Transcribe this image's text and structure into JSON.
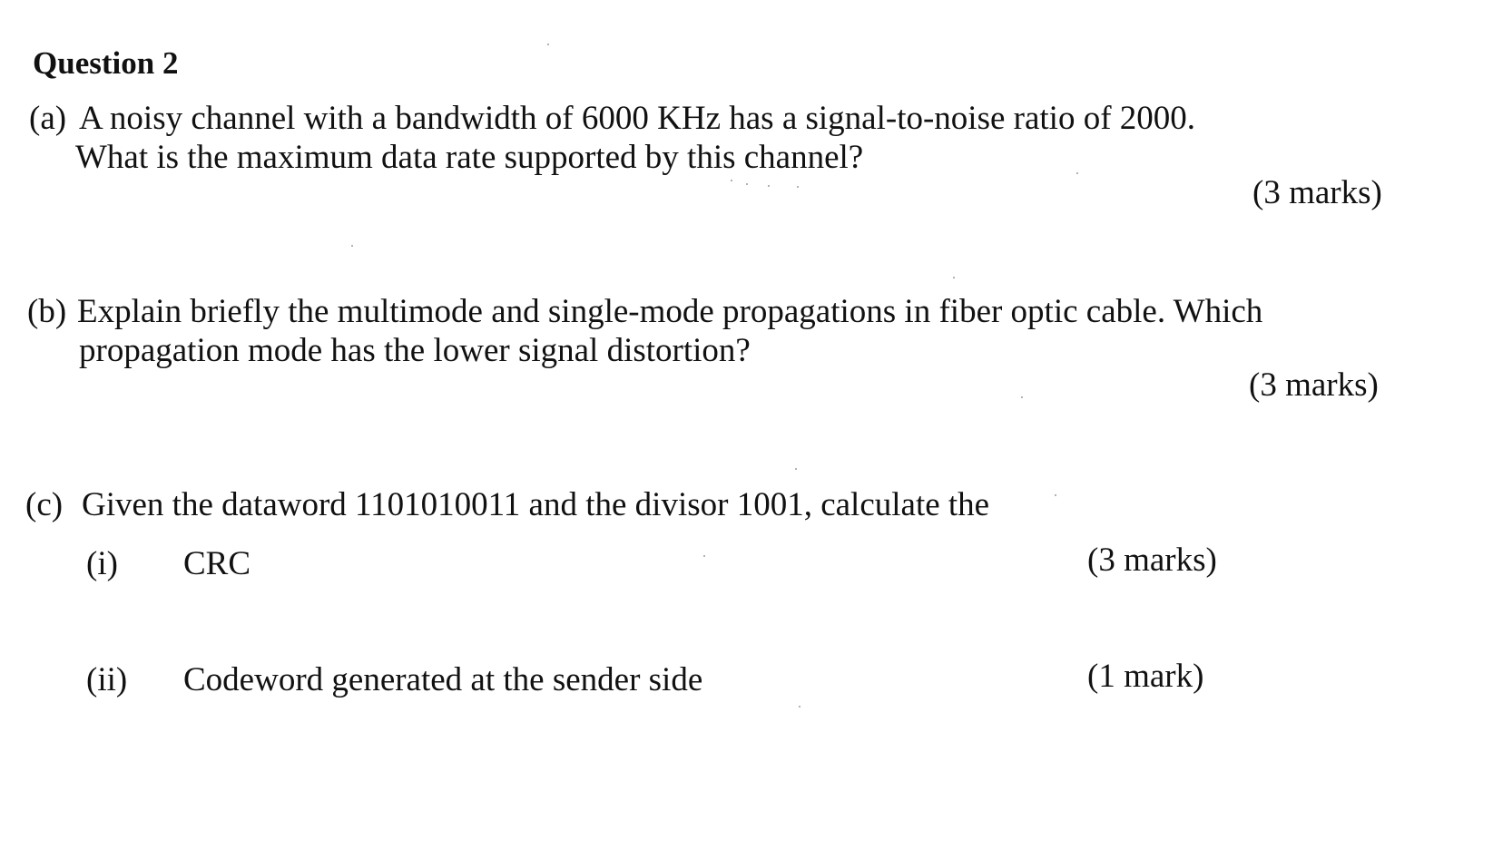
{
  "question": {
    "title": "Question 2",
    "parts": [
      {
        "label": "(a)",
        "line1": "A noisy channel with a bandwidth of 6000 KHz has a signal-to-noise ratio of 2000.",
        "line2": "What is the maximum data rate supported by this channel?",
        "marks": "(3 marks)"
      },
      {
        "label": "(b)",
        "line1": "Explain briefly the multimode and single-mode propagations in fiber optic cable. Which",
        "line2": "propagation mode has the lower signal distortion?",
        "marks": "(3 marks)"
      },
      {
        "label": "(c)",
        "line1": "Given the dataword 1101010011 and the divisor 1001, calculate the",
        "subparts": [
          {
            "label": "(i)",
            "text": "CRC",
            "marks": "(3 marks)"
          },
          {
            "label": "(ii)",
            "text": "Codeword generated at the sender side",
            "marks": "(1 mark)"
          }
        ]
      }
    ]
  }
}
